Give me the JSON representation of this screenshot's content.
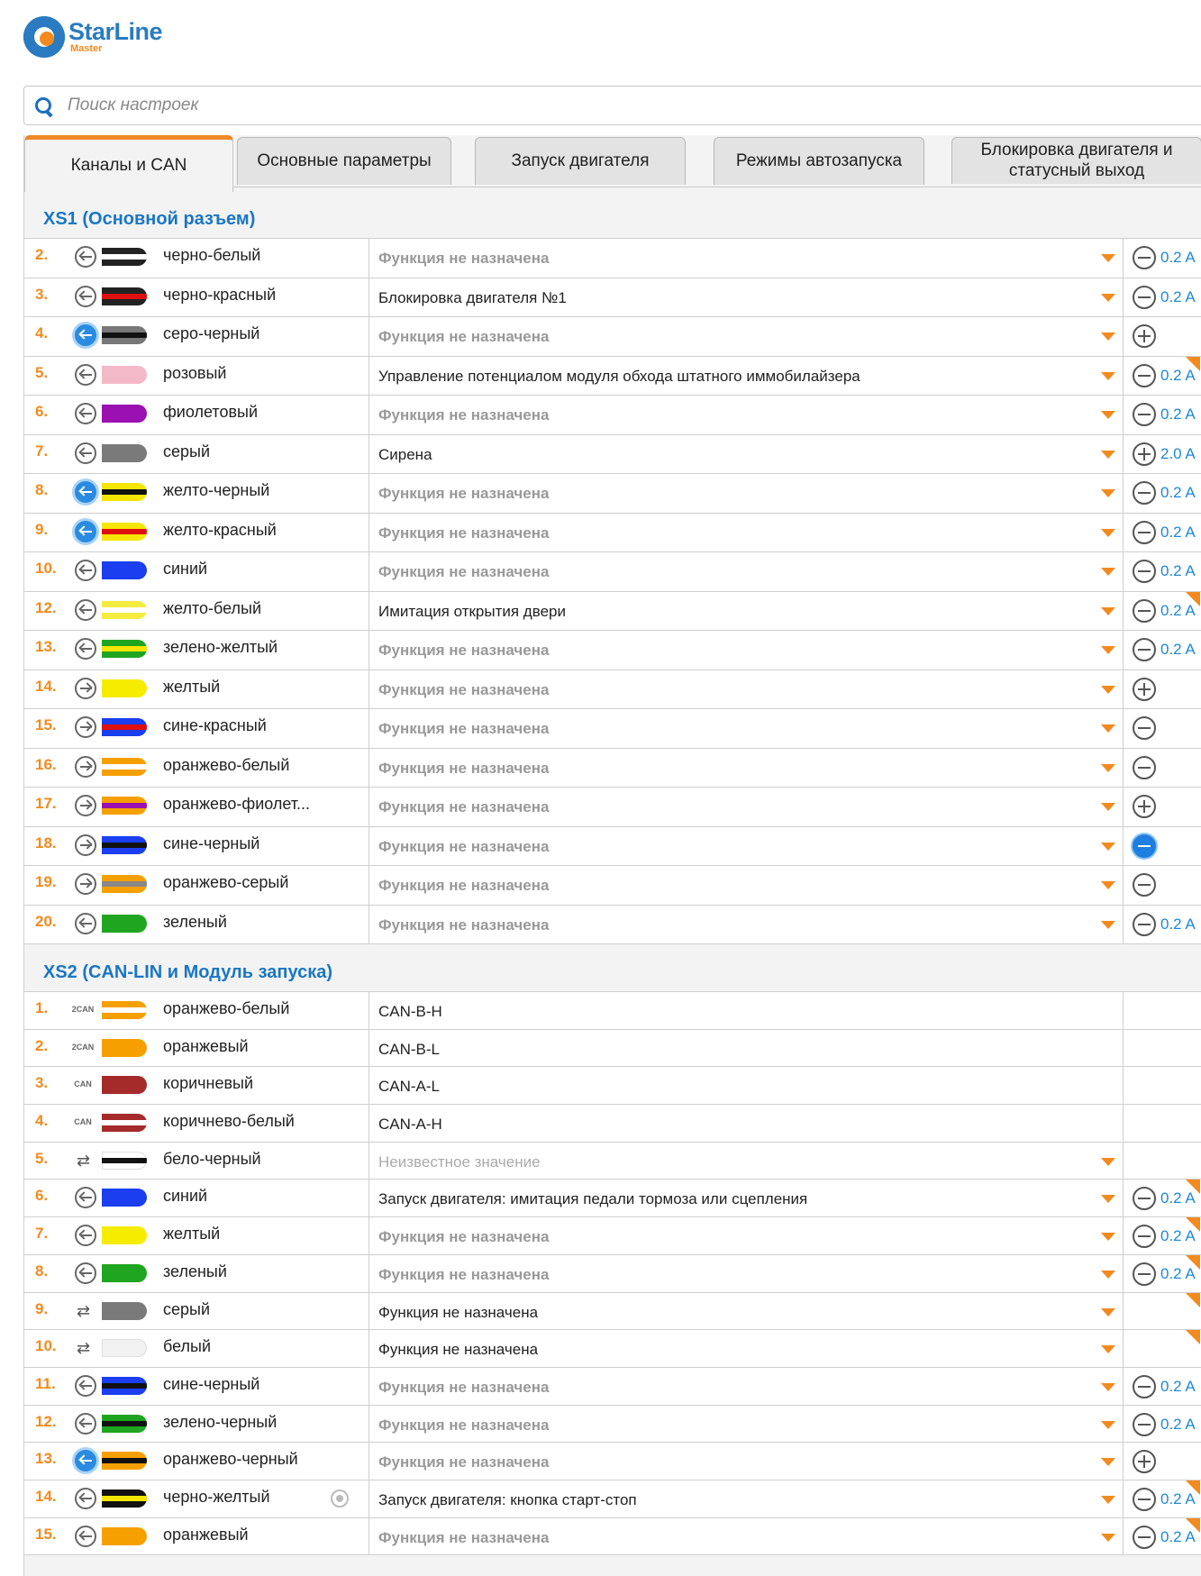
{
  "app": {
    "brand": "StarLine",
    "brand_sub": "Master"
  },
  "search": {
    "placeholder": "Поиск настроек"
  },
  "tabs": [
    {
      "label": "Каналы и CAN",
      "active": true
    },
    {
      "label": "Основные параметры"
    },
    {
      "label": "Запуск двигателя"
    },
    {
      "label": "Режимы автозапуска"
    },
    {
      "label": "Блокировка двигателя и статусный выход"
    }
  ],
  "colors": {
    "accent": "#f28a1e",
    "link": "#1a76c4"
  },
  "sections": [
    {
      "title": "XS1 (Основной разъем)",
      "rows": [
        {
          "num": "2.",
          "io": "in",
          "io_active": false,
          "wire": [
            "#222",
            "#fff"
          ],
          "name": "черно-белый",
          "fn": "Функция не назначена",
          "fn_kind": "na",
          "dropdown": true,
          "pol": "minus",
          "cur": "0.2 A",
          "corner": false
        },
        {
          "num": "3.",
          "io": "in",
          "io_active": false,
          "wire": [
            "#222",
            "#e01010"
          ],
          "name": "черно-красный",
          "fn": "Блокировка двигателя №1",
          "fn_kind": "set",
          "dropdown": true,
          "pol": "minus",
          "cur": "0.2 A",
          "corner": false
        },
        {
          "num": "4.",
          "io": "in",
          "io_active": true,
          "wire": [
            "#777",
            "#111"
          ],
          "name": "серо-черный",
          "fn": "Функция не назначена",
          "fn_kind": "na",
          "dropdown": true,
          "pol": "plus",
          "cur": "",
          "corner": false
        },
        {
          "num": "5.",
          "io": "in",
          "io_active": false,
          "wire": [
            "#f4b9c9",
            ""
          ],
          "name": "розовый",
          "fn": "Управление потенциалом модуля обхода штатного иммобилайзера",
          "fn_kind": "set",
          "dropdown": true,
          "pol": "minus",
          "cur": "0.2 A",
          "corner": true
        },
        {
          "num": "6.",
          "io": "in",
          "io_active": false,
          "wire": [
            "#9a10b0",
            ""
          ],
          "name": "фиолетовый",
          "fn": "Функция не назначена",
          "fn_kind": "na",
          "dropdown": true,
          "pol": "minus",
          "cur": "0.2 A",
          "corner": false
        },
        {
          "num": "7.",
          "io": "in",
          "io_active": false,
          "wire": [
            "#7a7a7a",
            ""
          ],
          "name": "серый",
          "fn": "Сирена",
          "fn_kind": "set",
          "dropdown": true,
          "pol": "plus",
          "cur": "2.0 A",
          "corner": false
        },
        {
          "num": "8.",
          "io": "in",
          "io_active": true,
          "wire": [
            "#f5e600",
            "#111"
          ],
          "name": "желто-черный",
          "fn": "Функция не назначена",
          "fn_kind": "na",
          "dropdown": true,
          "pol": "minus",
          "cur": "0.2 A",
          "corner": false
        },
        {
          "num": "9.",
          "io": "in",
          "io_active": true,
          "wire": [
            "#f5e600",
            "#e01010"
          ],
          "name": "желто-красный",
          "fn": "Функция не назначена",
          "fn_kind": "na",
          "dropdown": true,
          "pol": "minus",
          "cur": "0.2 A",
          "corner": false
        },
        {
          "num": "10.",
          "io": "in",
          "io_active": false,
          "wire": [
            "#1a3ef0",
            ""
          ],
          "name": "синий",
          "fn": "Функция не назначена",
          "fn_kind": "na",
          "dropdown": true,
          "pol": "minus",
          "cur": "0.2 A",
          "corner": false
        },
        {
          "num": "12.",
          "io": "in",
          "io_active": false,
          "wire": [
            "#f5ec40",
            "#fff"
          ],
          "name": "желто-белый",
          "fn": "Имитация открытия двери",
          "fn_kind": "set",
          "dropdown": true,
          "pol": "minus",
          "cur": "0.2 A",
          "corner": true
        },
        {
          "num": "13.",
          "io": "in",
          "io_active": false,
          "wire": [
            "#1fa51f",
            "#f5e600"
          ],
          "name": "зелено-желтый",
          "fn": "Функция не назначена",
          "fn_kind": "na",
          "dropdown": true,
          "pol": "minus",
          "cur": "0.2 A",
          "corner": false
        },
        {
          "num": "14.",
          "io": "out",
          "io_active": false,
          "wire": [
            "#f5ec00",
            ""
          ],
          "name": "желтый",
          "fn": "Функция не назначена",
          "fn_kind": "na",
          "dropdown": true,
          "pol": "plus",
          "cur": "",
          "corner": false
        },
        {
          "num": "15.",
          "io": "out",
          "io_active": false,
          "wire": [
            "#1a3ef0",
            "#e01010"
          ],
          "name": "сине-красный",
          "fn": "Функция не назначена",
          "fn_kind": "na",
          "dropdown": true,
          "pol": "minus",
          "cur": "",
          "corner": false
        },
        {
          "num": "16.",
          "io": "out",
          "io_active": false,
          "wire": [
            "#f5a000",
            "#fff"
          ],
          "name": "оранжево-белый",
          "fn": "Функция не назначена",
          "fn_kind": "na",
          "dropdown": true,
          "pol": "minus",
          "cur": "",
          "corner": false
        },
        {
          "num": "17.",
          "io": "out",
          "io_active": false,
          "wire": [
            "#f5a000",
            "#9a10b0"
          ],
          "name": "оранжево-фиолет...",
          "fn": "Функция не назначена",
          "fn_kind": "na",
          "dropdown": true,
          "pol": "plus",
          "cur": "",
          "corner": false
        },
        {
          "num": "18.",
          "io": "out",
          "io_active": false,
          "wire": [
            "#1a3ef0",
            "#111"
          ],
          "name": "сине-черный",
          "fn": "Функция не назначена",
          "fn_kind": "na",
          "dropdown": true,
          "pol": "active",
          "cur": "",
          "corner": false
        },
        {
          "num": "19.",
          "io": "out",
          "io_active": false,
          "wire": [
            "#f5a000",
            "#888"
          ],
          "name": "оранжево-серый",
          "fn": "Функция не назначена",
          "fn_kind": "na",
          "dropdown": true,
          "pol": "minus",
          "cur": "",
          "corner": false
        },
        {
          "num": "20.",
          "io": "in",
          "io_active": false,
          "wire": [
            "#1fa51f",
            ""
          ],
          "name": "зеленый",
          "fn": "Функция не назначена",
          "fn_kind": "na",
          "dropdown": true,
          "pol": "minus",
          "cur": "0.2 A",
          "corner": false
        }
      ]
    },
    {
      "title": "XS2 (CAN-LIN и Модуль запуска)",
      "rows": [
        {
          "num": "1.",
          "io": "can",
          "can": "2CAN",
          "wire": [
            "#f5a000",
            "#fff"
          ],
          "name": "оранжево-белый",
          "fn": "CAN-B-H",
          "fn_kind": "set",
          "dropdown": false,
          "pol": "",
          "cur": "",
          "corner": false
        },
        {
          "num": "2.",
          "io": "can",
          "can": "2CAN",
          "wire": [
            "#f5a000",
            ""
          ],
          "name": "оранжевый",
          "fn": "CAN-B-L",
          "fn_kind": "set",
          "dropdown": false,
          "pol": "",
          "cur": "",
          "corner": false
        },
        {
          "num": "3.",
          "io": "can",
          "can": "CAN",
          "wire": [
            "#a52a2a",
            ""
          ],
          "name": "коричневый",
          "fn": "CAN-A-L",
          "fn_kind": "set",
          "dropdown": false,
          "pol": "",
          "cur": "",
          "corner": false
        },
        {
          "num": "4.",
          "io": "can",
          "can": "CAN",
          "wire": [
            "#a52a2a",
            "#fff"
          ],
          "name": "коричнево-белый",
          "fn": "CAN-A-H",
          "fn_kind": "set",
          "dropdown": false,
          "pol": "",
          "cur": "",
          "corner": false
        },
        {
          "num": "5.",
          "io": "bidir",
          "wire": [
            "#fff",
            "#111"
          ],
          "name": "бело-черный",
          "fn": "Неизвестное значение",
          "fn_kind": "unknown",
          "dropdown": true,
          "pol": "",
          "cur": "",
          "corner": false
        },
        {
          "num": "6.",
          "io": "in",
          "io_active": false,
          "wire": [
            "#1a3ef0",
            ""
          ],
          "name": "синий",
          "fn": "Запуск двигателя: имитация педали тормоза или сцепления",
          "fn_kind": "set",
          "dropdown": true,
          "pol": "minus",
          "cur": "0.2 A",
          "corner": true
        },
        {
          "num": "7.",
          "io": "in",
          "io_active": false,
          "wire": [
            "#f5ec00",
            ""
          ],
          "name": "желтый",
          "fn": "Функция не назначена",
          "fn_kind": "na",
          "dropdown": true,
          "pol": "minus",
          "cur": "0.2 A",
          "corner": true
        },
        {
          "num": "8.",
          "io": "in",
          "io_active": false,
          "wire": [
            "#1fa51f",
            ""
          ],
          "name": "зеленый",
          "fn": "Функция не назначена",
          "fn_kind": "na",
          "dropdown": true,
          "pol": "minus",
          "cur": "0.2 A",
          "corner": true
        },
        {
          "num": "9.",
          "io": "bidir",
          "wire": [
            "#7a7a7a",
            ""
          ],
          "name": "серый",
          "fn": "Функция не назначена",
          "fn_kind": "set",
          "dropdown": true,
          "pol": "",
          "cur": "",
          "corner": true
        },
        {
          "num": "10.",
          "io": "bidir",
          "wire": [
            "#f2f2f2",
            ""
          ],
          "name": "белый",
          "fn": "Функция не назначена",
          "fn_kind": "set",
          "dropdown": true,
          "pol": "",
          "cur": "",
          "corner": true
        },
        {
          "num": "11.",
          "io": "in",
          "io_active": false,
          "wire": [
            "#1a3ef0",
            "#111"
          ],
          "name": "сине-черный",
          "fn": "Функция не назначена",
          "fn_kind": "na",
          "dropdown": true,
          "pol": "minus",
          "cur": "0.2 A",
          "corner": false
        },
        {
          "num": "12.",
          "io": "in",
          "io_active": false,
          "wire": [
            "#1fa51f",
            "#111"
          ],
          "name": "зелено-черный",
          "fn": "Функция не назначена",
          "fn_kind": "na",
          "dropdown": true,
          "pol": "minus",
          "cur": "0.2 A",
          "corner": false
        },
        {
          "num": "13.",
          "io": "in",
          "io_active": true,
          "wire": [
            "#f5a000",
            "#111"
          ],
          "name": "оранжево-черный",
          "fn": "Функция не назначена",
          "fn_kind": "na",
          "dropdown": true,
          "pol": "plus",
          "cur": "",
          "corner": false
        },
        {
          "num": "14.",
          "io": "in",
          "io_active": false,
          "wire": [
            "#111",
            "#f5e600"
          ],
          "name": "черно-желтый",
          "extra_icon": true,
          "fn": "Запуск двигателя: кнопка старт-стоп",
          "fn_kind": "set",
          "dropdown": true,
          "pol": "minus",
          "cur": "0.2 A",
          "corner": true
        },
        {
          "num": "15.",
          "io": "in",
          "io_active": false,
          "wire": [
            "#f5a000",
            ""
          ],
          "name": "оранжевый",
          "fn": "Функция не назначена",
          "fn_kind": "na",
          "dropdown": true,
          "pol": "minus",
          "cur": "0.2 A",
          "corner": true
        }
      ]
    }
  ]
}
